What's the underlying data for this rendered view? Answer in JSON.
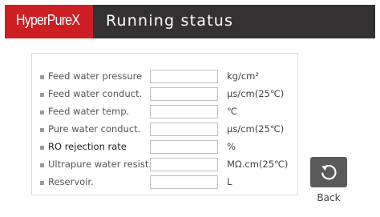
{
  "header": {
    "logo_text": "HyperPureX",
    "title": "Running status"
  },
  "colors": {
    "header_background": "#333132",
    "logo_background": "#cc1f24",
    "back_button_background": "#5a5a5a"
  },
  "status_rows": [
    {
      "label": "Feed water pressure",
      "value": "",
      "unit": "kg/cm²"
    },
    {
      "label": "Feed water conduct.",
      "value": "",
      "unit": "μs/cm(25℃)"
    },
    {
      "label": "Feed water temp.",
      "value": "",
      "unit": "℃"
    },
    {
      "label": "Pure water conduct.",
      "value": "",
      "unit": "μs/cm(25℃)"
    },
    {
      "label": "RO rejection rate",
      "value": "",
      "unit": "%"
    },
    {
      "label": "Ultrapure water resist.",
      "value": "",
      "unit": "MΩ.cm(25℃)"
    },
    {
      "label": "Reservoir.",
      "value": "",
      "unit": "L"
    }
  ],
  "back_button": {
    "icon": "undo-arrow-icon",
    "label": "Back"
  }
}
